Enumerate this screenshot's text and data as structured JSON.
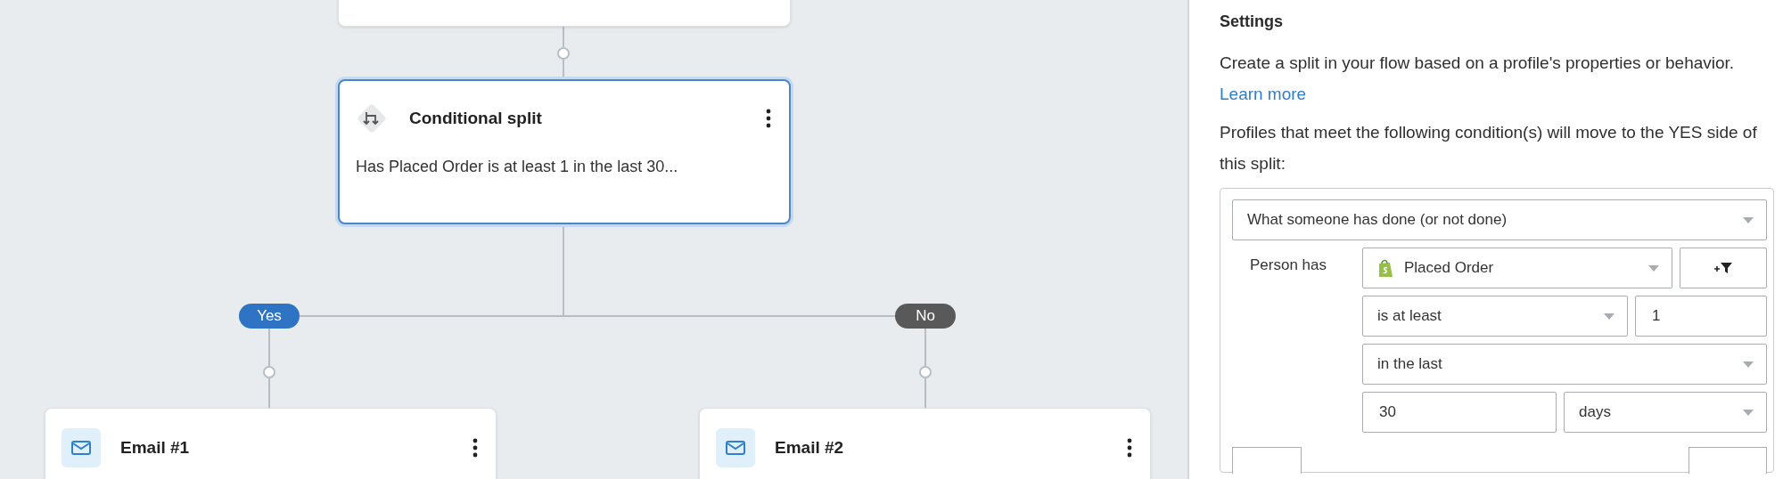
{
  "flow": {
    "split_node": {
      "title": "Conditional split",
      "description": "Has Placed Order is at least 1 in the last 30...",
      "selected": true
    },
    "branches": [
      {
        "label": "Yes",
        "color": "#2f73c4",
        "node": {
          "kind": "email",
          "title": "Email #1"
        }
      },
      {
        "label": "No",
        "color": "#595959",
        "node": {
          "kind": "email",
          "title": "Email #2"
        }
      }
    ]
  },
  "settings": {
    "title": "Settings",
    "intro": "Create a split in your flow based on a profile's properties or behavior.",
    "link": "Learn more",
    "condition_intro": "Profiles that meet the following condition(s) will move to the YES side of this split:",
    "condition": {
      "type": "What someone has done (or not done)",
      "subject_label": "Person has",
      "metric": "Placed Order",
      "operator": "is at least",
      "count": "1",
      "timeframe": "in the last",
      "amount": "30",
      "unit": "days"
    }
  }
}
